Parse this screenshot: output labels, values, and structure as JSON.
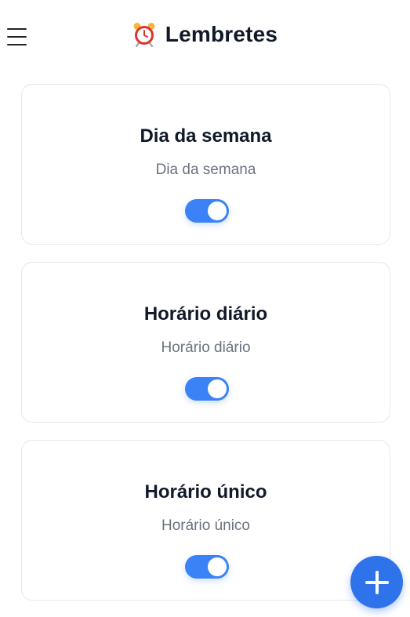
{
  "header": {
    "title": "Lembretes",
    "menu_icon": "hamburger-menu-icon",
    "title_icon": "alarm-clock-icon"
  },
  "reminders": [
    {
      "title": "Dia da semana",
      "subtitle": "Dia da semana",
      "enabled": true
    },
    {
      "title": "Horário diário",
      "subtitle": "Horário diário",
      "enabled": true
    },
    {
      "title": "Horário único",
      "subtitle": "Horário único",
      "enabled": true
    }
  ],
  "fab": {
    "icon": "plus-icon"
  },
  "colors": {
    "accent": "#3b82f6",
    "fab": "#2f73ea",
    "title_text": "#111827",
    "subtitle_text": "#6b7280",
    "card_border": "#e5e7eb"
  }
}
